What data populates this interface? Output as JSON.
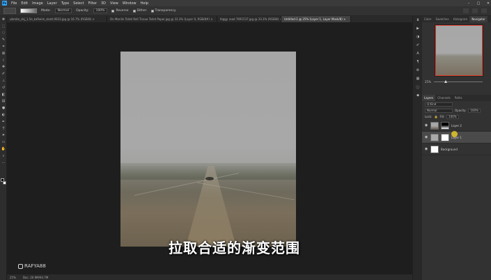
{
  "menu": {
    "logo": "Ps",
    "items": [
      "File",
      "Edit",
      "Image",
      "Layer",
      "Type",
      "Select",
      "Filter",
      "3D",
      "View",
      "Window",
      "Help"
    ],
    "window_controls": [
      "–",
      "□",
      "✕"
    ]
  },
  "options": {
    "mode_label": "Mode:",
    "mode_value": "Normal",
    "opacity_label": "Opacity:",
    "opacity_value": "100%",
    "reverse_label": "Reverse",
    "dither_label": "Dither",
    "transparency_label": "Transparency"
  },
  "tabs": [
    {
      "label": "ubmito_dsj_1.5e_kefkeim_skott.0033.jpg @ 16.7% (RGB/8) ×"
    },
    {
      "label": "On Marilin Toilet Roll Tissue Toilet Paper.jpg @ 33.3% (Layer 0, RGB/8#) ×"
    },
    {
      "label": "foggy road 7691537.jpg @ 33.3% (RGB/8) ×"
    },
    {
      "label": "Untitled-1 @ 25% (Layer 1, Layer Mask/8) ×"
    }
  ],
  "subtitle": "拉取合适的渐变范围",
  "watermark": "RAFYA88",
  "status": {
    "zoom": "25%",
    "doc": "Doc: 20.9M/93.7M"
  },
  "right_panel": {
    "top_tabs": [
      "Color",
      "Swatches",
      "Histogram",
      "Navigator"
    ],
    "active_top_tab": "Navigator",
    "zoom_value": "25%",
    "layer_tabs": [
      "Layers",
      "Channels",
      "Paths"
    ],
    "filter_label": "Q Kind",
    "blend_mode": "Normal",
    "opacity_label": "Opacity:",
    "opacity_value": "100%",
    "lock_label": "Lock:",
    "fill_label": "Fill:",
    "fill_value": "100%",
    "layers": [
      {
        "name": "Layer 2"
      },
      {
        "name": "Layer 1"
      },
      {
        "name": "Background"
      }
    ]
  },
  "colors": {
    "accent_red": "#e63a2a",
    "ps_blue": "#31a8ff"
  }
}
